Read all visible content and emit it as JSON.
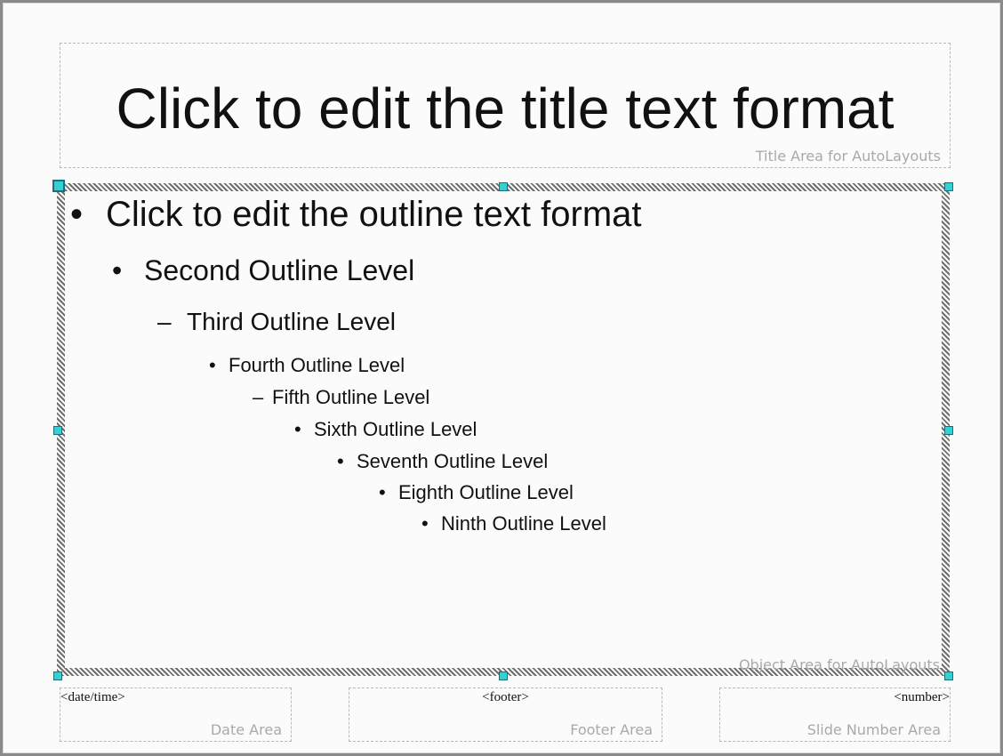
{
  "title_area": {
    "text": "Click to edit the title text format",
    "label": "Title Area for AutoLayouts"
  },
  "object_area": {
    "label": "Object Area for AutoLayouts",
    "levels": [
      {
        "bullet": "•",
        "text": "Click to edit the outline text format"
      },
      {
        "bullet": "•",
        "text": "Second Outline Level"
      },
      {
        "bullet": "–",
        "text": "Third Outline Level"
      },
      {
        "bullet": "•",
        "text": "Fourth Outline Level"
      },
      {
        "bullet": "–",
        "text": "Fifth Outline Level"
      },
      {
        "bullet": "•",
        "text": "Sixth Outline Level"
      },
      {
        "bullet": "•",
        "text": "Seventh Outline Level"
      },
      {
        "bullet": "•",
        "text": "Eighth Outline Level"
      },
      {
        "bullet": "•",
        "text": "Ninth Outline Level"
      }
    ]
  },
  "date_area": {
    "field": "<date/time>",
    "label": "Date Area"
  },
  "footer_area": {
    "field": "<footer>",
    "label": "Footer Area"
  },
  "number_area": {
    "field": "<number>",
    "label": "Slide Number Area"
  }
}
